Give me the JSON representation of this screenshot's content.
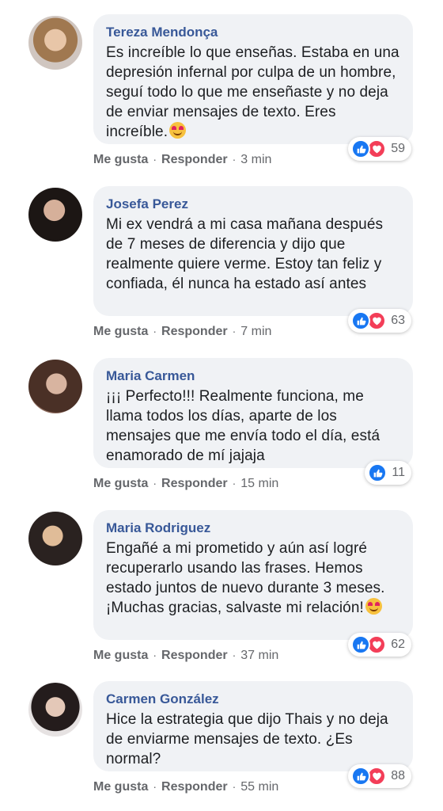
{
  "colors": {
    "name": "#385898",
    "bubble": "#f0f2f5",
    "meta": "#65676b",
    "like": "#1877f2",
    "love": "#f33e58"
  },
  "actions": {
    "like": "Me gusta",
    "reply": "Responder",
    "separator": "·"
  },
  "comments": [
    {
      "name": "Tereza Mendonça",
      "text": "Es increíble lo que enseñas. Estaba en una depresión infernal por culpa de un hombre, seguí todo lo que me enseñaste y no deja de enviar mensajes de texto. Eres increíble.",
      "emoji": "heart-eyes",
      "time": "3 min",
      "reaction_count": "59"
    },
    {
      "name": "Josefa Perez",
      "text": "Mi ex vendrá a mi casa mañana después de 7 meses de diferencia y dijo que realmente quiere verme. Estoy tan feliz y confiada, él nunca ha estado así antes",
      "time": "7 min",
      "reaction_count": "63"
    },
    {
      "name": "Maria Carmen",
      "text": "¡¡¡ Perfecto!!! Realmente funciona, me llama todos los días, aparte de los mensajes que me envía todo el día, está enamorado de mí jajaja",
      "time": "15 min",
      "reaction_count": "11"
    },
    {
      "name": "Maria Rodriguez",
      "text": "Engañé a mi prometido y aún así logré recuperarlo usando las frases. Hemos estado juntos de nuevo durante 3 meses. ¡Muchas gracias, salvaste mi relación!",
      "emoji": "smiling-face-with-hearts",
      "time": "37 min",
      "reaction_count": "62"
    },
    {
      "name": "Carmen González",
      "text": "Hice la estrategia que dijo Thais y no deja de enviarme mensajes de texto. ¿Es normal?",
      "time": "55 min",
      "reaction_count": "88"
    }
  ]
}
